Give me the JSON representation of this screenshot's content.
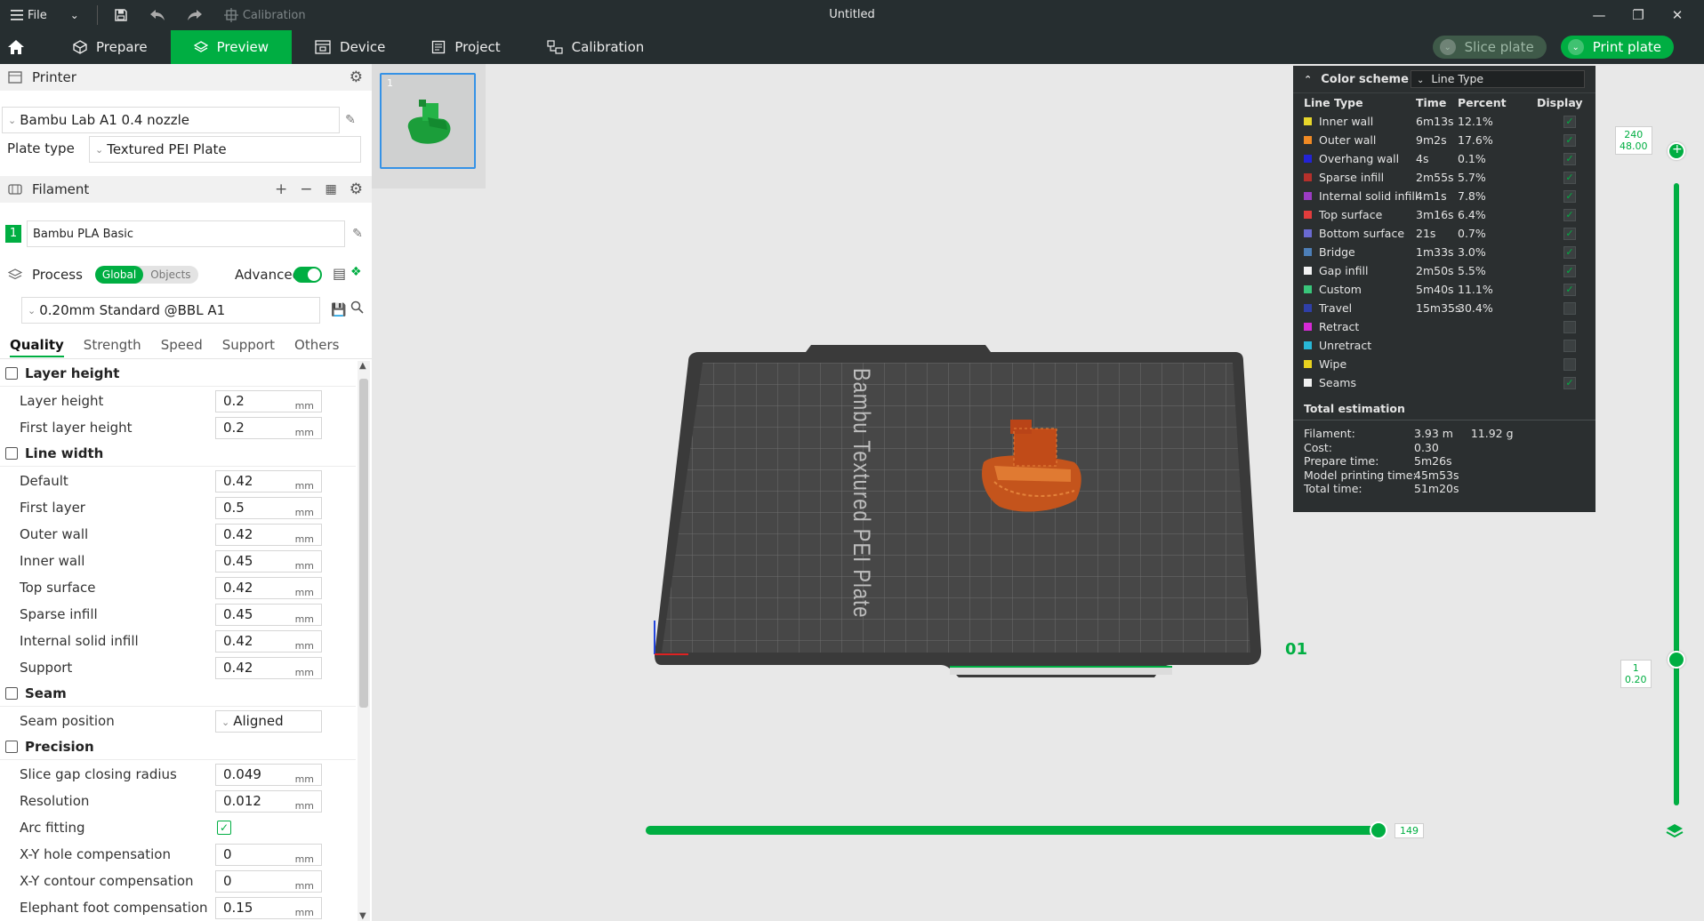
{
  "titlebar": {
    "file_label": "File",
    "calibration_label": "Calibration",
    "window_title": "Untitled"
  },
  "nav": {
    "tabs": [
      {
        "label": "Prepare"
      },
      {
        "label": "Preview"
      },
      {
        "label": "Device"
      },
      {
        "label": "Project"
      },
      {
        "label": "Calibration"
      }
    ],
    "active_tab": "Preview",
    "slice_label": "Slice plate",
    "print_label": "Print plate"
  },
  "printer": {
    "section_title": "Printer",
    "printer_name": "Bambu Lab A1 0.4 nozzle",
    "plate_type_label": "Plate type",
    "plate_type_value": "Textured PEI Plate"
  },
  "filament": {
    "section_title": "Filament",
    "slot_number": "1",
    "filament_name": "Bambu PLA Basic"
  },
  "process": {
    "section_title": "Process",
    "global_label": "Global",
    "objects_label": "Objects",
    "advanced_label": "Advanced",
    "preset": "0.20mm Standard @BBL  A1",
    "tabs": [
      "Quality",
      "Strength",
      "Speed",
      "Support",
      "Others"
    ],
    "active_tab": "Quality"
  },
  "params": {
    "unit": "mm",
    "groups": [
      {
        "title": "Layer height",
        "rows": [
          {
            "label": "Layer height",
            "value": "0.2"
          },
          {
            "label": "First layer height",
            "value": "0.2"
          }
        ]
      },
      {
        "title": "Line width",
        "rows": [
          {
            "label": "Default",
            "value": "0.42"
          },
          {
            "label": "First layer",
            "value": "0.5"
          },
          {
            "label": "Outer wall",
            "value": "0.42"
          },
          {
            "label": "Inner wall",
            "value": "0.45"
          },
          {
            "label": "Top surface",
            "value": "0.42"
          },
          {
            "label": "Sparse infill",
            "value": "0.45"
          },
          {
            "label": "Internal solid infill",
            "value": "0.42"
          },
          {
            "label": "Support",
            "value": "0.42"
          }
        ]
      },
      {
        "title": "Seam",
        "rows": [
          {
            "label": "Seam position",
            "value": "Aligned"
          }
        ]
      },
      {
        "title": "Precision",
        "rows": [
          {
            "label": "Slice gap closing radius",
            "value": "0.049"
          },
          {
            "label": "Resolution",
            "value": "0.012"
          },
          {
            "label": "Arc fitting",
            "value": ""
          },
          {
            "label": "X-Y hole compensation",
            "value": "0"
          },
          {
            "label": "X-Y contour compensation",
            "value": "0"
          },
          {
            "label": "Elephant foot compensation",
            "value": "0.15"
          }
        ]
      }
    ]
  },
  "viewport": {
    "plate_thumb_number": "1",
    "plate_label_text": "Bambu Textured PEI Plate",
    "plate_number": "01"
  },
  "legend": {
    "title": "Color scheme",
    "scheme": "Line Type",
    "col_line_type": "Line Type",
    "col_time": "Time",
    "col_percent": "Percent",
    "col_display": "Display",
    "rows": [
      {
        "name": "Inner wall",
        "time": "6m13s",
        "percent": "12.1%",
        "color": "#e7d62b",
        "checked": true
      },
      {
        "name": "Outer wall",
        "time": "9m2s",
        "percent": "17.6%",
        "color": "#f08a24",
        "checked": true
      },
      {
        "name": "Overhang wall",
        "time": "4s",
        "percent": "0.1%",
        "color": "#2323d6",
        "checked": true
      },
      {
        "name": "Sparse infill",
        "time": "2m55s",
        "percent": "5.7%",
        "color": "#b5302b",
        "checked": true
      },
      {
        "name": "Internal solid infill",
        "time": "4m1s",
        "percent": "7.8%",
        "color": "#9b3cc4",
        "checked": true
      },
      {
        "name": "Top surface",
        "time": "3m16s",
        "percent": "6.4%",
        "color": "#e23c3c",
        "checked": true
      },
      {
        "name": "Bottom surface",
        "time": "21s",
        "percent": "0.7%",
        "color": "#6a6ad1",
        "checked": true
      },
      {
        "name": "Bridge",
        "time": "1m33s",
        "percent": "3.0%",
        "color": "#4d7fb8",
        "checked": true
      },
      {
        "name": "Gap infill",
        "time": "2m50s",
        "percent": "5.5%",
        "color": "#f2f2f2",
        "checked": true
      },
      {
        "name": "Custom",
        "time": "5m40s",
        "percent": "11.1%",
        "color": "#39c57a",
        "checked": true
      },
      {
        "name": "Travel",
        "time": "15m35s",
        "percent": "30.4%",
        "color": "#2f3fa8",
        "checked": false
      },
      {
        "name": "Retract",
        "time": "",
        "percent": "",
        "color": "#d62ad6",
        "checked": false
      },
      {
        "name": "Unretract",
        "time": "",
        "percent": "",
        "color": "#28b7d6",
        "checked": false
      },
      {
        "name": "Wipe",
        "time": "",
        "percent": "",
        "color": "#e8d21f",
        "checked": false
      },
      {
        "name": "Seams",
        "time": "",
        "percent": "",
        "color": "#f0f0f0",
        "checked": true
      }
    ],
    "total_title": "Total estimation",
    "estimates": [
      {
        "label": "Filament:",
        "value": "3.93 m     11.92 g"
      },
      {
        "label": "Cost:",
        "value": "0.30"
      },
      {
        "label": "Prepare time:",
        "value": "5m26s"
      },
      {
        "label": "Model printing time:",
        "value": "45m53s"
      },
      {
        "label": "Total time:",
        "value": "51m20s"
      }
    ]
  },
  "sliders": {
    "vertical_top_layer": "240",
    "vertical_top_height": "48.00",
    "vertical_bottom_layer": "1",
    "vertical_bottom_height": "0.20",
    "horizontal_value": "149"
  },
  "colors": {
    "accent": "#00ae42",
    "titlebar": "#262e30",
    "legend_bg": "#2b2f30"
  }
}
